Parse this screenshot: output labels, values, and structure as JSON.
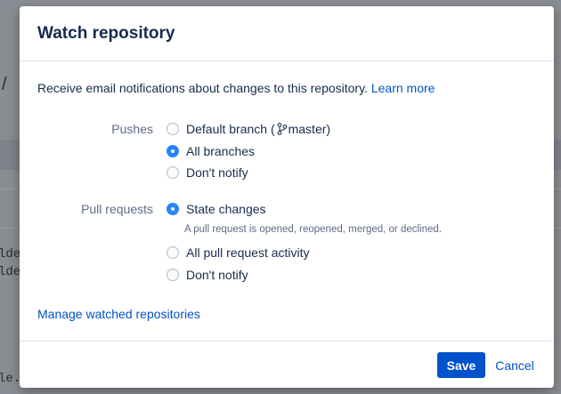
{
  "background": {
    "slash": "/",
    "code_lines": [
      "lde",
      "lde",
      "le."
    ]
  },
  "dialog": {
    "title": "Watch repository",
    "description": "Receive email notifications about changes to this repository.",
    "learn_more": "Learn more",
    "pushes": {
      "label": "Pushes",
      "options": {
        "default_branch_prefix": "Default branch (",
        "default_branch_name": "master)",
        "all_branches": "All branches",
        "dont_notify": "Don't notify"
      },
      "selected": "all_branches"
    },
    "pull_requests": {
      "label": "Pull requests",
      "options": {
        "state_changes": "State changes",
        "state_changes_help": "A pull request is opened, reopened, merged, or declined.",
        "all_activity": "All pull request activity",
        "dont_notify": "Don't notify"
      },
      "selected": "state_changes"
    },
    "manage_link": "Manage watched repositories",
    "footer": {
      "save": "Save",
      "cancel": "Cancel"
    }
  },
  "colors": {
    "primary": "#0052cc",
    "radio_checked": "#2684ff",
    "muted_text": "#5e6c84"
  },
  "icons": {
    "branch": "branch-icon"
  }
}
